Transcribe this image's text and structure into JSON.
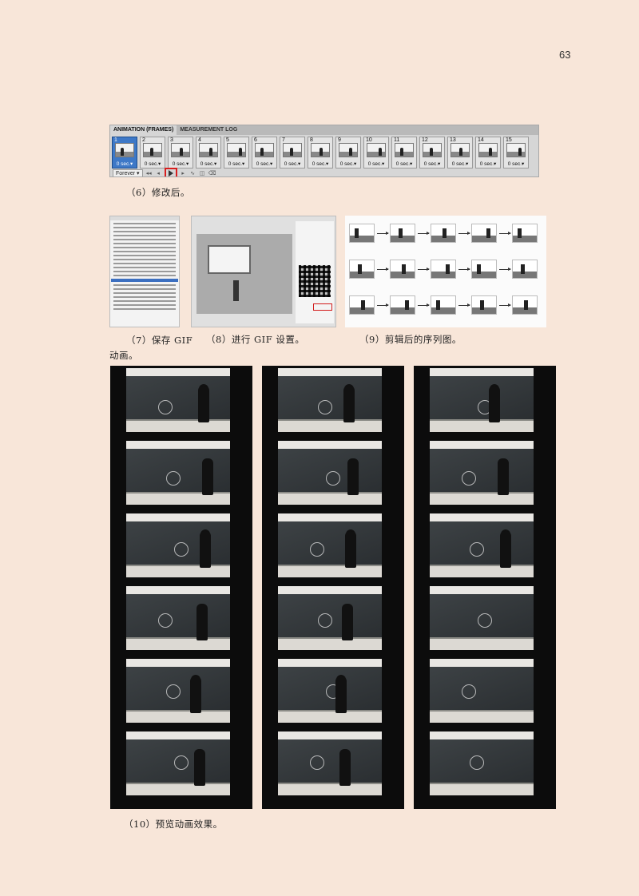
{
  "page_number": "63",
  "animation_panel": {
    "tabs": [
      "ANIMATION (FRAMES)",
      "MEASUREMENT LOG"
    ],
    "frames": [
      {
        "num": "1",
        "delay": "0 sec.▾"
      },
      {
        "num": "2",
        "delay": "0 sec.▾"
      },
      {
        "num": "3",
        "delay": "0 sec.▾"
      },
      {
        "num": "4",
        "delay": "0 sec.▾"
      },
      {
        "num": "5",
        "delay": "0 sec.▾"
      },
      {
        "num": "6",
        "delay": "0 sec.▾"
      },
      {
        "num": "7",
        "delay": "0 sec.▾"
      },
      {
        "num": "8",
        "delay": "0 sec.▾"
      },
      {
        "num": "9",
        "delay": "0 sec.▾"
      },
      {
        "num": "10",
        "delay": "0 sec.▾"
      },
      {
        "num": "11",
        "delay": "0 sec.▾"
      },
      {
        "num": "12",
        "delay": "0 sec.▾"
      },
      {
        "num": "13",
        "delay": "0 sec.▾"
      },
      {
        "num": "14",
        "delay": "0 sec.▾"
      },
      {
        "num": "15",
        "delay": "0 sec.▾"
      }
    ],
    "loop_option": "Forever ▾",
    "highlight_color": "#d81e1e",
    "selected_frame_color": "#3d78c7"
  },
  "captions": {
    "c6": "（6）修改后。",
    "c7_line1": "（7）保存 GIF",
    "c7_line2": "动画。",
    "c8": "（8）进行 GIF 设置。",
    "c9": "（9）剪辑后的序列图。",
    "c10": "（10）预览动画效果。"
  },
  "film_strip_count": 3,
  "frames_per_strip": 6
}
